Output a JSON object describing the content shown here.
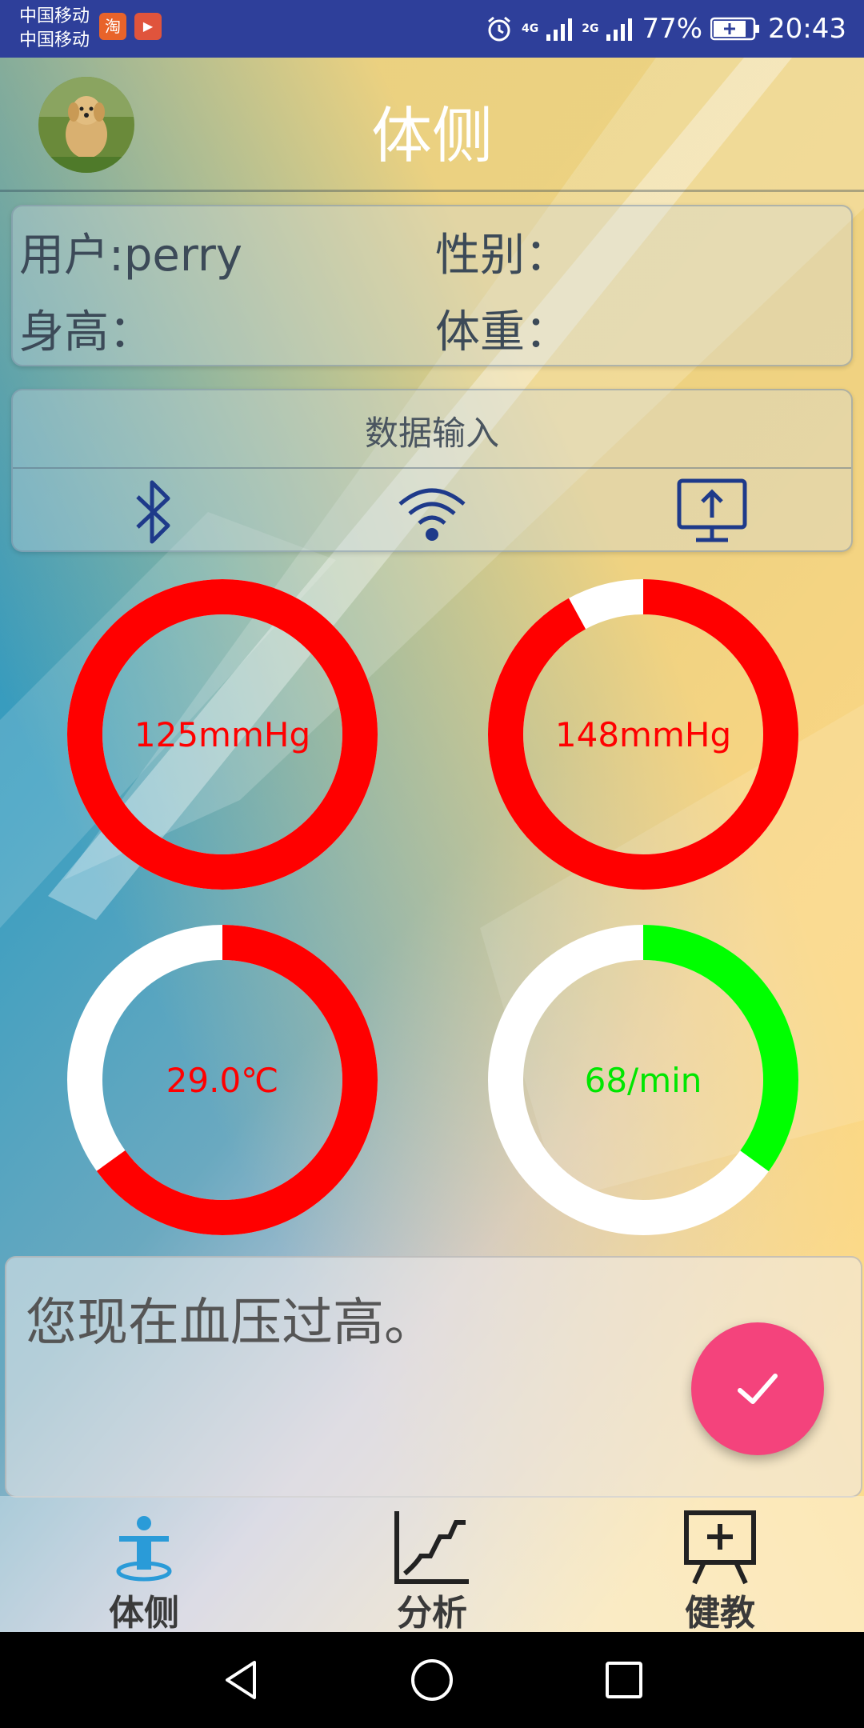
{
  "status_bar": {
    "carrier_1": "中国移动",
    "carrier_2": "中国移动",
    "app_badge_1": "淘",
    "app_badge_2": "▶",
    "net_1": "4G",
    "net_2": "2G",
    "battery": "77%",
    "time": "20:43"
  },
  "header": {
    "title": "体侧"
  },
  "user_info": {
    "user": "用户:perry",
    "gender": "性别：",
    "height": "身高：",
    "weight": "体重："
  },
  "data_input": {
    "title": "数据输入",
    "icons": [
      "bluetooth-icon",
      "wifi-icon",
      "monitor-upload-icon"
    ]
  },
  "gauges": [
    {
      "label": "125mmHg",
      "color": "#ff0000",
      "fraction": 1.0
    },
    {
      "label": "148mmHg",
      "color": "#ff0000",
      "fraction": 0.92
    },
    {
      "label": "29.0℃",
      "color": "#ff0000",
      "fraction": 0.65
    },
    {
      "label": "68/min",
      "color": "#00ff00",
      "fraction": 0.35
    }
  ],
  "advice": {
    "text": "您现在血压过高。"
  },
  "bottom_nav": {
    "items": [
      {
        "label": "体侧",
        "icon": "body-measure-icon",
        "color": "#3a3a3a"
      },
      {
        "label": "分析",
        "icon": "chart-trend-icon",
        "color": "#3a3a3a"
      },
      {
        "label": "健教",
        "icon": "presentation-board-icon",
        "color": "#3a3a3a"
      }
    ]
  },
  "colors": {
    "accent_fab": "#f4437c",
    "status_bar": "#2e3f9a",
    "icon_blue": "#1e3a8a"
  }
}
